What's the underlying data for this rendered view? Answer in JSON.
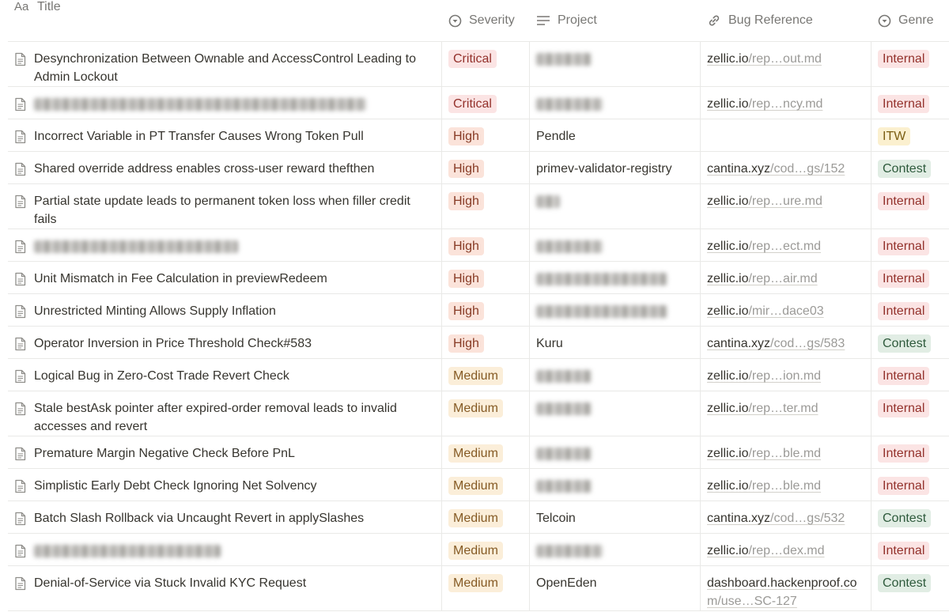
{
  "headers": {
    "title": "Title",
    "severity": "Severity",
    "project": "Project",
    "bug_reference": "Bug Reference",
    "genre": "Genre"
  },
  "colors": {
    "critical_bg": "#fbe4e4",
    "high_bg": "#fbe3da",
    "medium_bg": "#fbeed9",
    "internal_bg": "#fbe4e4",
    "itw_bg": "#fbf0cf",
    "contest_bg": "#e1ede4"
  },
  "rows": [
    {
      "title": "Desynchronization Between Ownable and AccessControl Leading to Admin Lockout",
      "severity": "Critical",
      "project": "",
      "ref_domain": "zellic.io",
      "ref_path": "/rep…out.md",
      "genre": "Internal"
    },
    {
      "title": "",
      "severity": "Critical",
      "project": "",
      "ref_domain": "zellic.io",
      "ref_path": "/rep…ncy.md",
      "genre": "Internal"
    },
    {
      "title": "Incorrect Variable in PT Transfer Causes Wrong Token Pull",
      "severity": "High",
      "project": "Pendle",
      "ref_domain": "",
      "ref_path": "",
      "genre": "ITW"
    },
    {
      "title": "Shared override address enables cross-user reward thefthen",
      "severity": "High",
      "project": "primev-validator-registry",
      "ref_domain": "cantina.xyz",
      "ref_path": "/cod…gs/152",
      "genre": "Contest"
    },
    {
      "title": "Partial state update leads to permanent token loss when filler credit fails",
      "severity": "High",
      "project": "",
      "ref_domain": "zellic.io",
      "ref_path": "/rep…ure.md",
      "genre": "Internal"
    },
    {
      "title": "",
      "severity": "High",
      "project": "",
      "ref_domain": "zellic.io",
      "ref_path": "/rep…ect.md",
      "genre": "Internal"
    },
    {
      "title": "Unit Mismatch in Fee Calculation in previewRedeem",
      "severity": "High",
      "project": "",
      "ref_domain": "zellic.io",
      "ref_path": "/rep…air.md",
      "genre": "Internal"
    },
    {
      "title": "Unrestricted Minting Allows Supply Inflation",
      "severity": "High",
      "project": "",
      "ref_domain": "zellic.io",
      "ref_path": "/mir…dace03",
      "genre": "Internal"
    },
    {
      "title": "Operator Inversion in Price Threshold Check#583",
      "severity": "High",
      "project": "Kuru",
      "ref_domain": "cantina.xyz",
      "ref_path": "/cod…gs/583",
      "genre": "Contest"
    },
    {
      "title": "Logical Bug in Zero-Cost Trade Revert Check",
      "severity": "Medium",
      "project": "",
      "ref_domain": "zellic.io",
      "ref_path": "/rep…ion.md",
      "genre": "Internal"
    },
    {
      "title": "Stale bestAsk pointer after expired-order removal leads to invalid accesses and revert",
      "severity": "Medium",
      "project": "",
      "ref_domain": "zellic.io",
      "ref_path": "/rep…ter.md",
      "genre": "Internal"
    },
    {
      "title": "Premature Margin Negative Check Before PnL",
      "severity": "Medium",
      "project": "",
      "ref_domain": "zellic.io",
      "ref_path": "/rep…ble.md",
      "genre": "Internal"
    },
    {
      "title": "Simplistic Early Debt Check Ignoring Net Solvency",
      "severity": "Medium",
      "project": "",
      "ref_domain": "zellic.io",
      "ref_path": "/rep…ble.md",
      "genre": "Internal"
    },
    {
      "title": "Batch Slash Rollback via Uncaught Revert in applySlashes",
      "severity": "Medium",
      "project": "Telcoin",
      "ref_domain": "cantina.xyz",
      "ref_path": "/cod…gs/532",
      "genre": "Contest"
    },
    {
      "title": "",
      "severity": "Medium",
      "project": "",
      "ref_domain": "zellic.io",
      "ref_path": "/rep…dex.md",
      "genre": "Internal"
    },
    {
      "title": "Denial-of-Service via Stuck Invalid KYC Request",
      "severity": "Medium",
      "project": "OpenEden",
      "ref_domain": "dashboard.hackenproof.co",
      "ref_path": "m/use…SC-127",
      "genre": "Contest"
    }
  ]
}
